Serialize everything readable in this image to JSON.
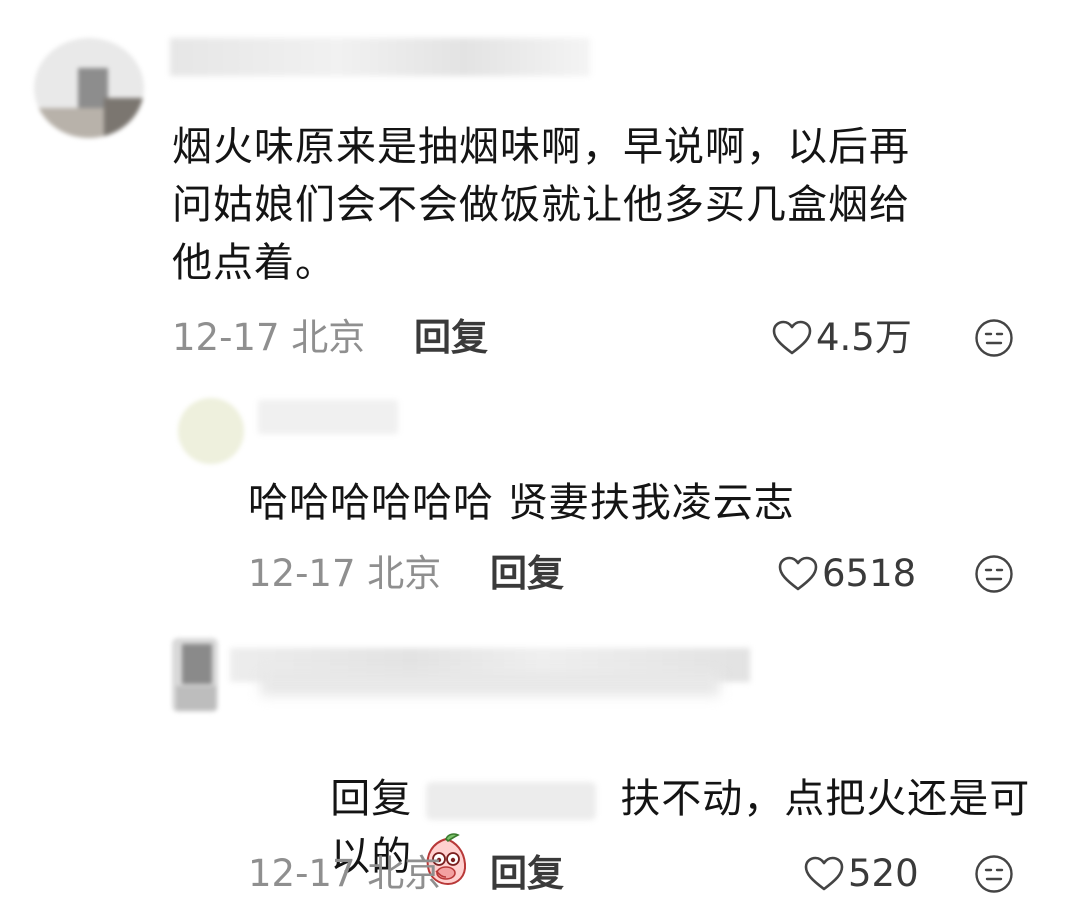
{
  "comments": [
    {
      "text": "烟火味原来是抽烟味啊，早说啊，以后再\n问姑娘们会不会做饭就让他多买几盒烟给\n他点着。",
      "date": "12-17 北京",
      "reply_label": "回复",
      "likes": "4.5万"
    },
    {
      "text": "哈哈哈哈哈哈 贤妻扶我凌云志",
      "date": "12-17 北京",
      "reply_label": "回复",
      "likes": "6518"
    },
    {
      "reply_prefix": "回复",
      "text_after": "扶不动，点把火还是可",
      "text_line2": "以的",
      "date": "12-17 北京",
      "reply_label": "回复",
      "likes": "520"
    }
  ],
  "icons": {
    "like": "heart-outline-icon",
    "dislike": "neutral-face-icon",
    "sticker": "peach-emoji-sticker"
  },
  "colors": {
    "text": "#141414",
    "meta": "#8f8f8f",
    "accent_sticker": "#f29a9a"
  }
}
